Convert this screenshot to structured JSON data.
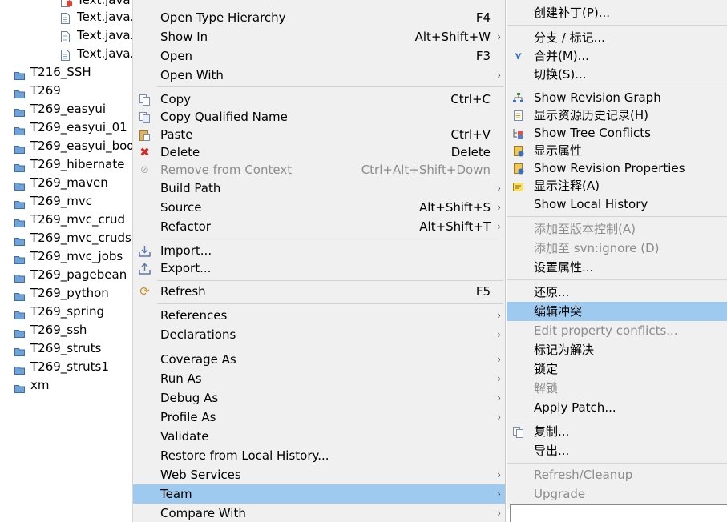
{
  "tree": {
    "files": [
      "Text.java",
      "Text.java.",
      "Text.java.",
      "Text.java."
    ],
    "projects": [
      "T216_SSH",
      "T269",
      "T269_easyui",
      "T269_easyui_01",
      "T269_easyui_boo",
      "T269_hibernate",
      "T269_maven",
      "T269_mvc",
      "T269_mvc_crud",
      "T269_mvc_cruds",
      "T269_mvc_jobs",
      "T269_pagebean",
      "T269_python",
      "T269_spring",
      "T269_ssh",
      "T269_struts",
      "T269_struts1",
      "xm"
    ]
  },
  "menu": {
    "open_type_hierarchy": {
      "label": "Open Type Hierarchy",
      "shortcut": "F4"
    },
    "show_in": {
      "label": "Show In",
      "shortcut": "Alt+Shift+W"
    },
    "open": {
      "label": "Open",
      "shortcut": "F3"
    },
    "open_with": {
      "label": "Open With"
    },
    "copy": {
      "label": "Copy",
      "shortcut": "Ctrl+C"
    },
    "copy_qualified_name": {
      "label": "Copy Qualified Name"
    },
    "paste": {
      "label": "Paste",
      "shortcut": "Ctrl+V"
    },
    "delete": {
      "label": "Delete",
      "shortcut": "Delete"
    },
    "remove_from_context": {
      "label": "Remove from Context",
      "shortcut": "Ctrl+Alt+Shift+Down"
    },
    "build_path": {
      "label": "Build Path"
    },
    "source": {
      "label": "Source",
      "shortcut": "Alt+Shift+S"
    },
    "refactor": {
      "label": "Refactor",
      "shortcut": "Alt+Shift+T"
    },
    "import": {
      "label": "Import..."
    },
    "export": {
      "label": "Export..."
    },
    "refresh": {
      "label": "Refresh",
      "shortcut": "F5"
    },
    "references": {
      "label": "References"
    },
    "declarations": {
      "label": "Declarations"
    },
    "coverage_as": {
      "label": "Coverage As"
    },
    "run_as": {
      "label": "Run As"
    },
    "debug_as": {
      "label": "Debug As"
    },
    "profile_as": {
      "label": "Profile As"
    },
    "validate": {
      "label": "Validate"
    },
    "restore_local_history": {
      "label": "Restore from Local History..."
    },
    "web_services": {
      "label": "Web Services"
    },
    "team": {
      "label": "Team"
    },
    "compare_with": {
      "label": "Compare With"
    }
  },
  "submenu": {
    "create_patch": "创建补丁(P)...",
    "branch_tag": "分支 / 标记...",
    "merge": "合并(M)...",
    "switch": "切换(S)...",
    "show_revision_graph": "Show Revision Graph",
    "show_history": "显示资源历史记录(H)",
    "show_tree_conflicts": "Show Tree Conflicts",
    "show_properties": "显示属性",
    "show_revision_properties": "Show Revision Properties",
    "show_annotation": "显示注释(A)",
    "show_local_history": "Show Local History",
    "add_to_version_control": "添加至版本控制(A)",
    "add_to_svn_ignore": "添加至 svn:ignore (D)",
    "set_property": "设置属性...",
    "revert": "还原...",
    "edit_conflicts": "编辑冲突",
    "edit_property_conflicts": "Edit property conflicts...",
    "mark_resolved": "标记为解决",
    "lock": "锁定",
    "unlock": "解锁",
    "apply_patch": "Apply Patch...",
    "copy": "复制...",
    "export": "导出...",
    "refresh_cleanup": "Refresh/Cleanup",
    "upgrade": "Upgrade"
  },
  "colors": {
    "menu_bg": "#f0f0f0",
    "highlight": "#9ecaf0",
    "disabled_text": "#8c8c8c"
  }
}
